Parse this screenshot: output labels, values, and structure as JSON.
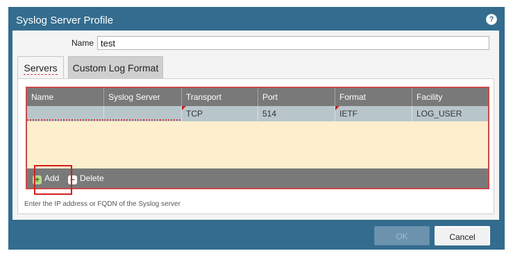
{
  "dialog": {
    "title": "Syslog Server Profile",
    "help_icon": "question-circle-icon",
    "help_glyph": "?"
  },
  "name_field": {
    "label": "Name",
    "value": "test"
  },
  "tabs": [
    {
      "label": "Servers",
      "active": true
    },
    {
      "label": "Custom Log Format",
      "active": false
    }
  ],
  "grid": {
    "columns": [
      "Name",
      "Syslog Server",
      "Transport",
      "Port",
      "Format",
      "Facility"
    ],
    "rows": [
      {
        "name": "",
        "syslog_server": "",
        "transport": "TCP",
        "port": "514",
        "format": "IETF",
        "facility": "LOG_USER"
      }
    ]
  },
  "toolbar": {
    "add_label": "Add",
    "add_icon": "plus-icon",
    "add_glyph": "+",
    "delete_label": "Delete",
    "delete_icon": "minus-icon",
    "delete_glyph": "−"
  },
  "hint": "Enter the IP address or FQDN of the Syslog server",
  "buttons": {
    "ok": "OK",
    "cancel": "Cancel"
  },
  "colors": {
    "dialog_bg": "#336c8e",
    "grid_header": "#797979",
    "selected_row": "#b8c6cb",
    "grid_empty": "#fdefcd",
    "error_red": "#d41e1e"
  }
}
